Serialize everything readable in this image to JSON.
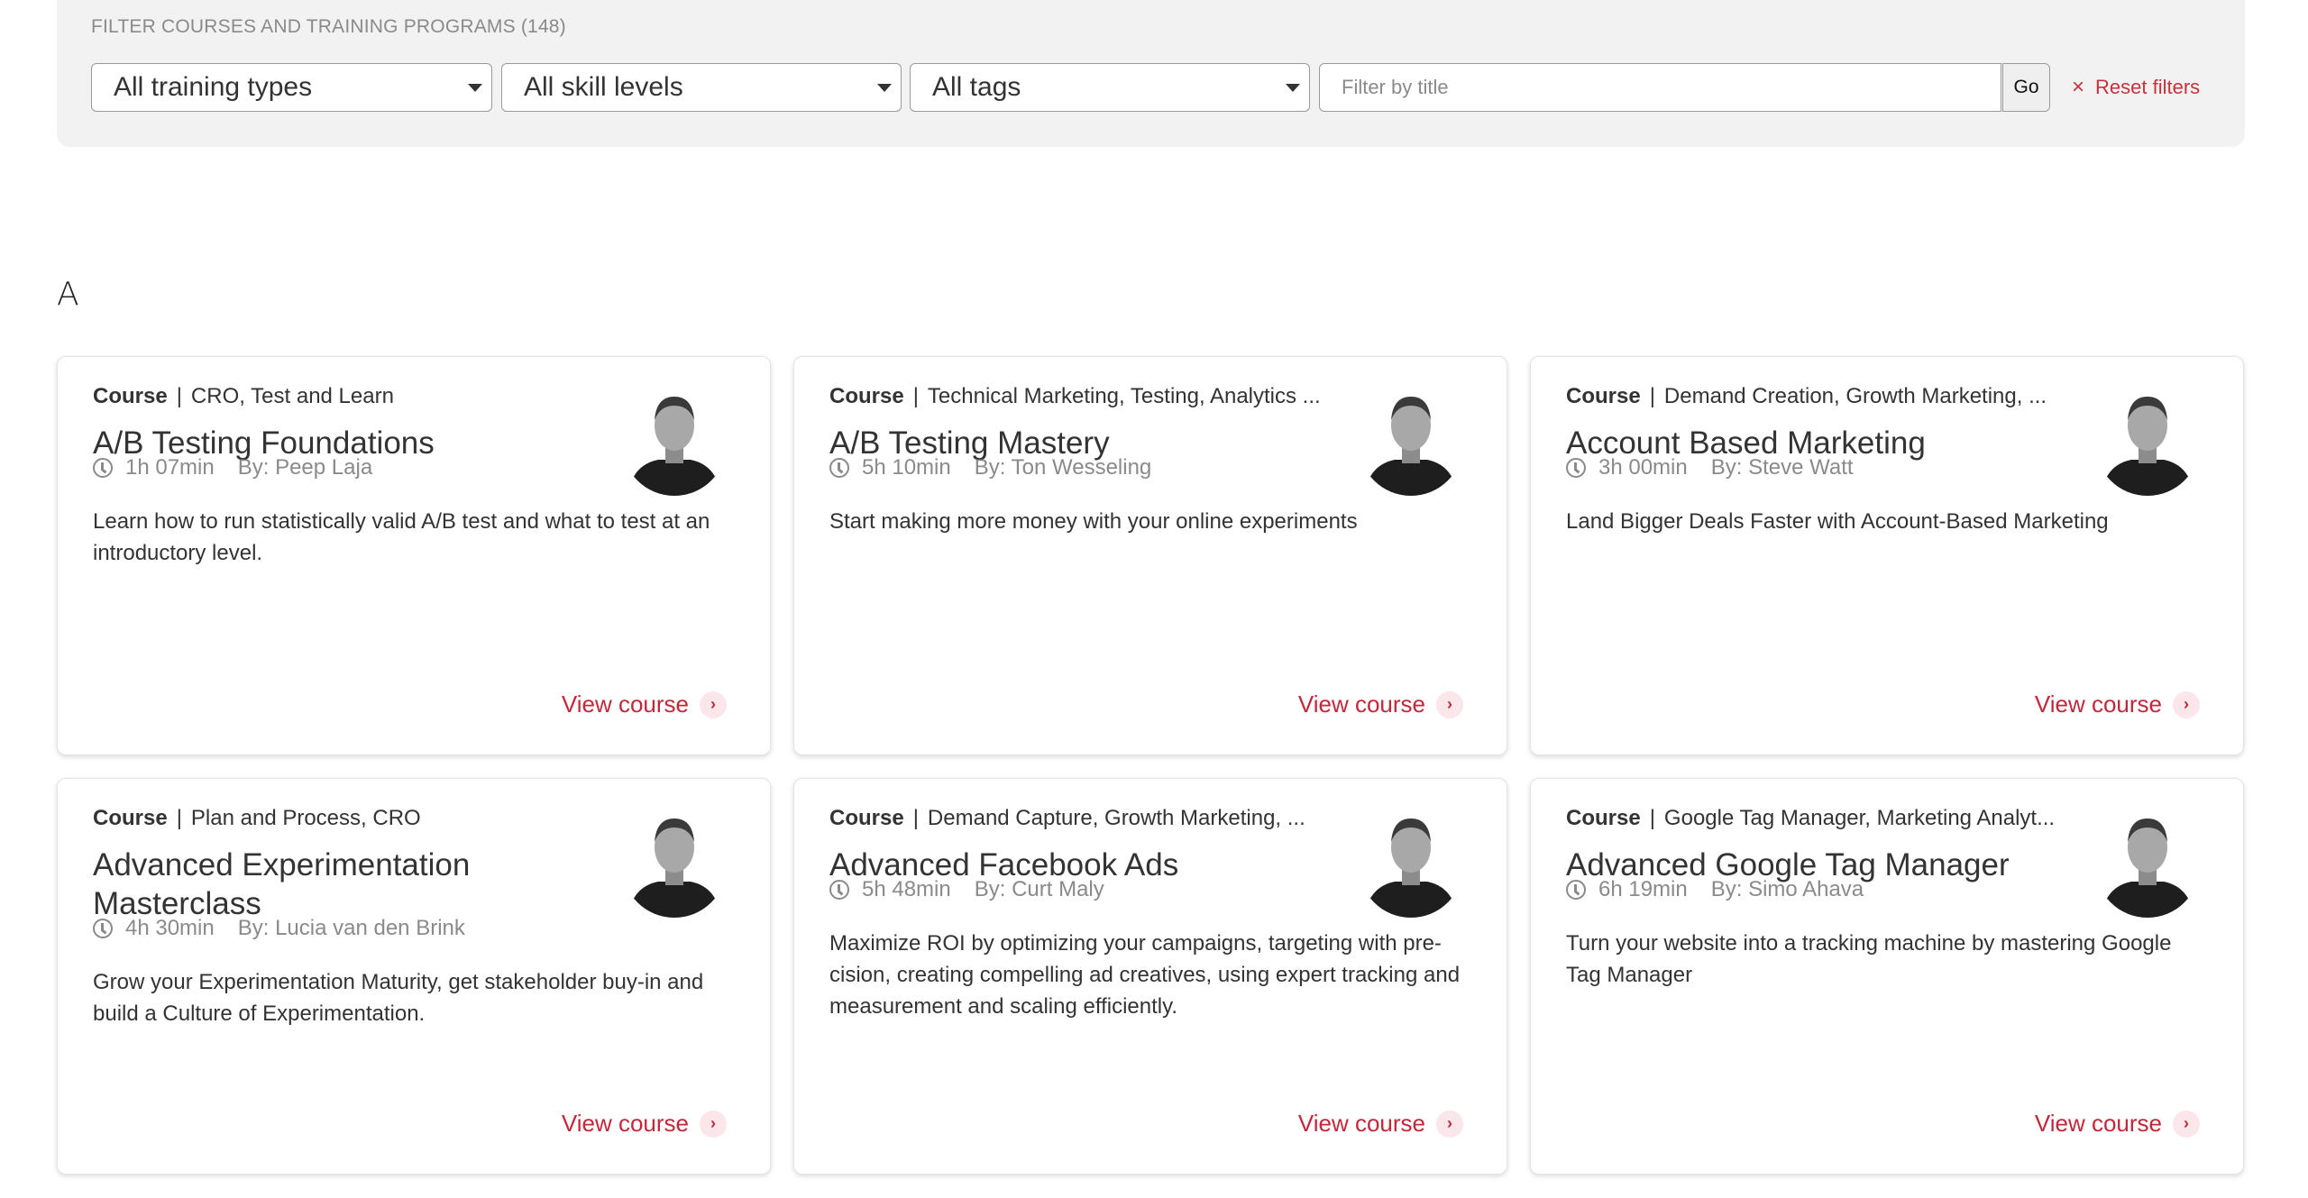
{
  "filters": {
    "label": "FILTER COURSES AND TRAINING PROGRAMS (148)",
    "training_type": "All training types",
    "skill_level": "All skill levels",
    "tags": "All tags",
    "title_placeholder": "Filter by title",
    "title_value": "",
    "go_label": "Go",
    "reset_icon": "×",
    "reset_label": "Reset filters"
  },
  "colors": {
    "accent": "#c4263a",
    "panel_bg": "#f2f2f2"
  },
  "section": {
    "letter": "A"
  },
  "courses": [
    {
      "type": "Course",
      "tags": "CRO, Test and Learn",
      "title": "A/B Testing Foundations",
      "duration": "1h 07min",
      "author": "By: Peep Laja",
      "description": "Learn how to run statistically valid A/B test and what to test at an introductory level.",
      "link_label": "View course",
      "avatar_icon": "instructor-photo"
    },
    {
      "type": "Course",
      "tags": "Technical Marketing, Testing, Analytics ...",
      "title": "A/B Testing Mastery",
      "duration": "5h 10min",
      "author": "By: Ton Wesseling",
      "description": "Start making more money with your online experiments",
      "link_label": "View course",
      "avatar_icon": "instructor-photo"
    },
    {
      "type": "Course",
      "tags": "Demand Creation, Growth Marketing, ...",
      "title": "Account Based Marketing",
      "duration": "3h 00min",
      "author": "By: Steve Watt",
      "description": "Land Bigger Deals Faster with Account-Based Marketing",
      "link_label": "View course",
      "avatar_icon": "instructor-photo"
    },
    {
      "type": "Course",
      "tags": "Plan and Process, CRO",
      "title": "Advanced Experimentation Masterclass",
      "duration": "4h 30min",
      "author": "By: Lucia van den Brink",
      "description": "Grow your Experimentation Maturity, get stakeholder buy-in and build a Culture of Experimentation.",
      "link_label": "View course",
      "avatar_icon": "instructor-photo"
    },
    {
      "type": "Course",
      "tags": "Demand Capture, Growth Marketing, ...",
      "title": "Advanced Facebook Ads",
      "duration": "5h 48min",
      "author": "By: Curt Maly",
      "description": "Maximize ROI by optimizing your campaigns, targeting with pre-cision, creating compelling ad creatives, using expert tracking and measurement and scaling efficiently.",
      "link_label": "View course",
      "avatar_icon": "instructor-photo"
    },
    {
      "type": "Course",
      "tags": "Google Tag Manager, Marketing Analyt...",
      "title": "Advanced Google Tag Manager",
      "duration": "6h 19min",
      "author": "By: Simo Ahava",
      "description": "Turn your website into a tracking machine by mastering Google Tag Manager",
      "link_label": "View course",
      "avatar_icon": "instructor-photo"
    }
  ]
}
